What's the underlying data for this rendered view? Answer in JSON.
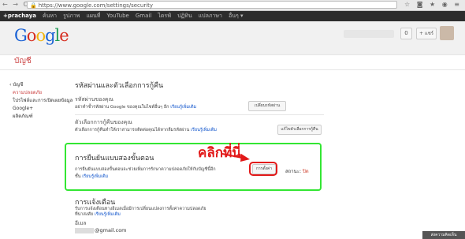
{
  "browser": {
    "nav_glyphs": "← → C",
    "url": "https://www.google.com/settings/security",
    "ext_glyphs": "☆ ◙ ★ ◉ ≡"
  },
  "gbar": [
    "+prachaya",
    "ค้นหา",
    "รูปภาพ",
    "แผนที่",
    "YouTube",
    "Gmail",
    "ไดรฟ์",
    "ปฏิทิน",
    "แปลภาษา",
    "อื่นๆ ▾"
  ],
  "header": {
    "logo": [
      "G",
      "o",
      "o",
      "g",
      "l",
      "e"
    ],
    "notif_count": "0",
    "share_label": "+ แชร์"
  },
  "page_title": "บัญชี",
  "sidebar": [
    {
      "label": "‹ บัญชี",
      "active": false
    },
    {
      "label": "ความปลอดภัย",
      "active": true
    },
    {
      "label": "โปรไฟล์และการเปิดเผยข้อมูล",
      "active": false
    },
    {
      "label": "Google+",
      "active": false
    },
    {
      "label": "ผลิตภัณฑ์",
      "active": false
    }
  ],
  "password_section": {
    "title": "รหัสผ่านและตัวเลือกการกู้คืน",
    "password_title": "รหัสผ่านของคุณ",
    "password_desc": "อย่าทำซ้ำรหัสผ่าน Google ของคุณในไซต์อื่นๆ อีก",
    "password_link": "เรียนรู้เพิ่มเติม",
    "password_btn": "เปลี่ยนรหัสผ่าน",
    "recovery_title": "ตัวเลือกการกู้คืนของคุณ",
    "recovery_desc": "ตัวเลือกการกู้คืนทำให้เราสามารถติดต่อคุณได้หากลืมรหัสผ่าน",
    "recovery_link": "เรียนรู้เพิ่มเติม",
    "recovery_btn": "แก้ไขตัวเลือกการกู้คืน"
  },
  "two_step": {
    "title": "การยืนยันแบบสองขั้นตอน",
    "desc_line1": "การยืนยันแบบสองขั้นตอนจะช่วยเพิ่มการรักษาความปลอดภัยให้กับบัญชีนี้อีก",
    "desc_line2": "ชั้น",
    "link": "เรียนรู้เพิ่มเติม",
    "setup_btn": "การตั้งค่า",
    "status_label": "สถานะ:",
    "status_value": "ปิด",
    "callout": "คลิกที่นี่"
  },
  "notifications": {
    "title": "การแจ้งเตือน",
    "desc_line1": "รับการแจ้งเตือนทางอีเมลเมื่อมีการเปลี่ยนแปลงการตั้งค่าความปลอดภัย",
    "desc_line2": "ที่น่าสงสัย",
    "link": "เรียนรู้เพิ่มเติม",
    "email_label": "อีเมล",
    "email_value": "@gmail.com"
  },
  "feedback_label": "ส่งความคิดเห็น",
  "colors": {
    "green_highlight": "#33e633",
    "red_callout": "#e21919",
    "link_blue": "#1155cc"
  }
}
